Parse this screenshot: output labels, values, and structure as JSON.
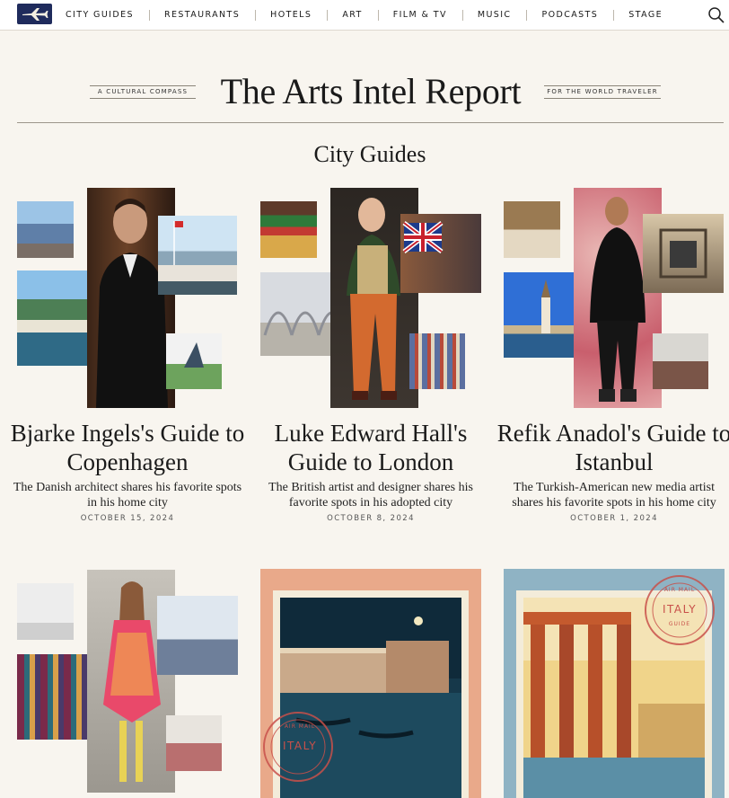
{
  "nav": {
    "logo_icon": "airplane-logo-icon",
    "items": [
      "CITY GUIDES",
      "RESTAURANTS",
      "HOTELS",
      "ART",
      "FILM & TV",
      "MUSIC",
      "PODCASTS",
      "STAGE"
    ],
    "search_icon": "search-icon"
  },
  "masthead": {
    "tagline_left": "A CULTURAL COMPASS",
    "title": "The Arts Intel Report",
    "tagline_right": "FOR THE WORLD TRAVELER"
  },
  "section": {
    "title": "City Guides"
  },
  "cards": [
    {
      "title": "Bjarke Ingels's Guide to Copenhagen",
      "description": "The Danish architect shares his favorite spots in his home city",
      "date": "OCTOBER 15, 2024"
    },
    {
      "title": "Luke Edward Hall's Guide to London",
      "description": "The British artist and designer shares his favorite spots in his adopted city",
      "date": "OCTOBER 8, 2024"
    },
    {
      "title": "Refik Anadol's Guide to Istanbul",
      "description": "The Turkish-American new media artist shares his favorite spots in his home city",
      "date": "OCTOBER 1, 2024"
    }
  ],
  "posters": {
    "stamp_top": "AIR MAIL",
    "stamp_country": "ITALY",
    "stamp_bottom": "GUIDE"
  },
  "colors": {
    "background": "#f8f5ef",
    "logo_bg": "#1f2b5c",
    "stamp_red": "#c8504a"
  }
}
